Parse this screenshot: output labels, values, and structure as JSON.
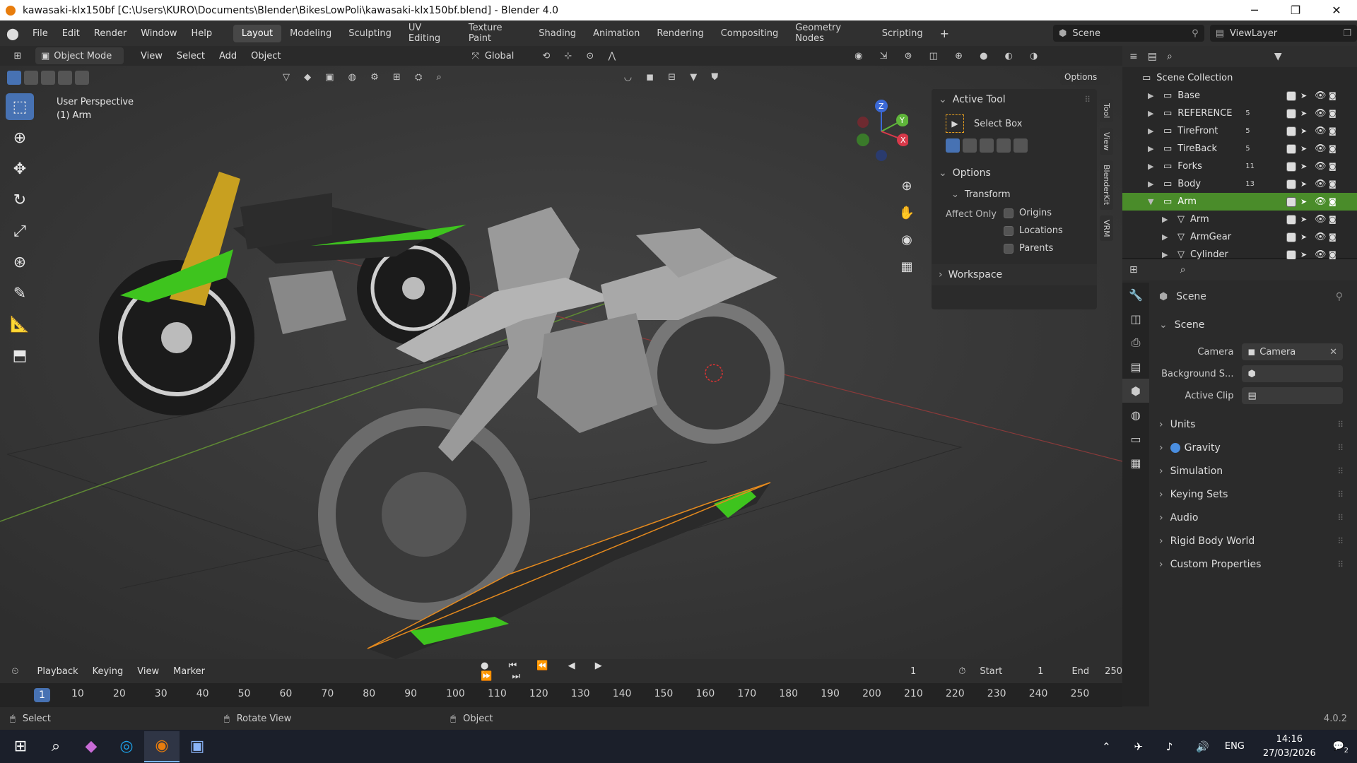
{
  "window": {
    "title": "kawasaki-klx150bf [C:\\Users\\KURO\\Documents\\Blender\\BikesLowPoli\\kawasaki-klx150bf.blend] - Blender 4.0"
  },
  "menu": [
    "File",
    "Edit",
    "Render",
    "Window",
    "Help"
  ],
  "workspaces": [
    "Layout",
    "Modeling",
    "Sculpting",
    "UV Editing",
    "Texture Paint",
    "Shading",
    "Animation",
    "Rendering",
    "Compositing",
    "Geometry Nodes",
    "Scripting"
  ],
  "active_workspace": "Layout",
  "scene_field": "Scene",
  "viewlayer_field": "ViewLayer",
  "viewport_header": {
    "mode": "Object Mode",
    "menus": [
      "View",
      "Select",
      "Add",
      "Object"
    ],
    "transform": "Global",
    "options": "Options"
  },
  "viewport_overlay": {
    "perspective": "User Perspective",
    "object": "(1) Arm"
  },
  "gizmo_axes": [
    "Z",
    "Y",
    "X"
  ],
  "npanel": {
    "active_tool": "Active Tool",
    "tool_name": "Select Box",
    "options": "Options",
    "transform": "Transform",
    "affect_only": "Affect Only",
    "origins": "Origins",
    "locations": "Locations",
    "parents": "Parents",
    "workspace": "Workspace"
  },
  "side_tabs": [
    "Tool",
    "View",
    "BlenderKit",
    "VRM"
  ],
  "outliner": {
    "root": "Scene Collection",
    "items": [
      {
        "name": "Base",
        "count": ""
      },
      {
        "name": "REFERENCE",
        "count": "5"
      },
      {
        "name": "TireFront",
        "count": "5"
      },
      {
        "name": "TireBack",
        "count": "5"
      },
      {
        "name": "Forks",
        "count": "11"
      },
      {
        "name": "Body",
        "count": "13"
      },
      {
        "name": "Arm",
        "count": ""
      },
      {
        "name": "Arm",
        "count": ""
      },
      {
        "name": "ArmGear",
        "count": ""
      },
      {
        "name": "Cylinder",
        "count": ""
      }
    ]
  },
  "properties": {
    "context": "Scene",
    "panel": "Scene",
    "camera_label": "Camera",
    "camera_value": "Camera",
    "background_label": "Background S...",
    "active_clip_label": "Active Clip",
    "sections": [
      "Units",
      "Gravity",
      "Simulation",
      "Keying Sets",
      "Audio",
      "Rigid Body World",
      "Custom Properties"
    ]
  },
  "timeline": {
    "menus": [
      "Playback",
      "Keying",
      "View",
      "Marker"
    ],
    "current_frame": "1",
    "start_label": "Start",
    "start": "1",
    "end_label": "End",
    "end": "250",
    "ticks": [
      "1",
      "10",
      "20",
      "30",
      "40",
      "50",
      "60",
      "70",
      "80",
      "90",
      "100",
      "110",
      "120",
      "130",
      "140",
      "150",
      "160",
      "170",
      "180",
      "190",
      "200",
      "210",
      "220",
      "230",
      "240",
      "250"
    ]
  },
  "status": {
    "select": "Select",
    "rotate": "Rotate View",
    "object": "Object",
    "version": "4.0.2"
  },
  "taskbar": {
    "lang": "ENG",
    "time": "14:16",
    "date": "27/03/2026",
    "notif": "2"
  }
}
